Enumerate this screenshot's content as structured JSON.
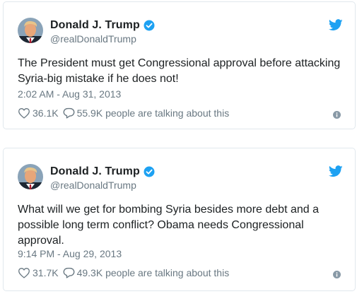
{
  "tweets": [
    {
      "name": "Donald J. Trump",
      "handle": "@realDonaldTrump",
      "text": "The President must get Congressional approval before attacking Syria-big mistake if he does not!",
      "timestamp": "2:02 AM - Aug 31, 2013",
      "likes": "36.1K",
      "talking": "55.9K people are talking about this"
    },
    {
      "name": "Donald J. Trump",
      "handle": "@realDonaldTrump",
      "text": "What will we get for bombing Syria besides more debt and a possible long term conflict? Obama needs Congressional approval.",
      "timestamp": "9:14 PM - Aug 29, 2013",
      "likes": "31.7K",
      "talking": "49.3K people are talking about this"
    }
  ],
  "icons": {
    "verified": "verified-badge-icon",
    "twitter": "twitter-bird-icon",
    "like": "heart-icon",
    "reply": "speech-bubble-icon",
    "info": "info-icon"
  },
  "colors": {
    "accent": "#1da1f2",
    "text": "#1c2022",
    "muted": "#697882",
    "border": "#e1e8ed"
  }
}
